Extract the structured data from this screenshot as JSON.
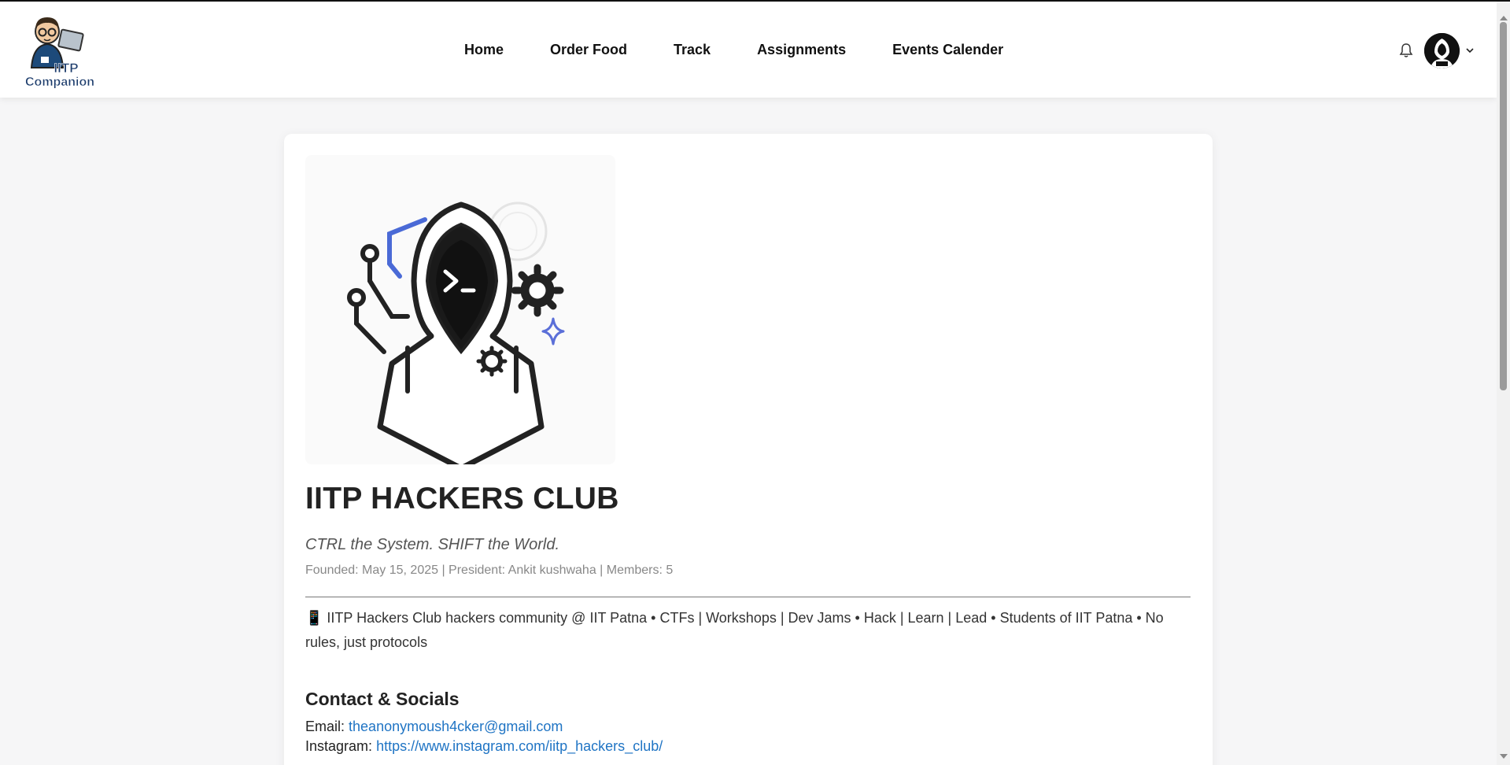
{
  "header": {
    "logo_text": "IITP Companion",
    "nav": [
      {
        "label": "Home"
      },
      {
        "label": "Order Food"
      },
      {
        "label": "Track"
      },
      {
        "label": "Assignments"
      },
      {
        "label": "Events Calender"
      }
    ],
    "icons": {
      "notifications": "bell-icon",
      "profile": "avatar",
      "menu": "chevron-down-icon"
    }
  },
  "club": {
    "title": "IITP HACKERS CLUB",
    "tagline": "CTRL the System. SHIFT the World.",
    "meta": "Founded: May 15, 2025 | President: Ankit kushwaha | Members: 5",
    "description": "📱 IITP Hackers Club hackers community @ IIT Patna • CTFs | Workshops | Dev Jams • Hack | Learn | Lead • Students of IIT Patna • No rules, just protocols"
  },
  "contact": {
    "heading": "Contact & Socials",
    "email_label": "Email:",
    "email": "theanonymoush4cker@gmail.com",
    "instagram_label": "Instagram:",
    "instagram": "https://www.instagram.com/iitp_hackers_club/"
  },
  "colors": {
    "link": "#1f74c4",
    "accent": "#5b6fd8",
    "text": "#222222"
  }
}
